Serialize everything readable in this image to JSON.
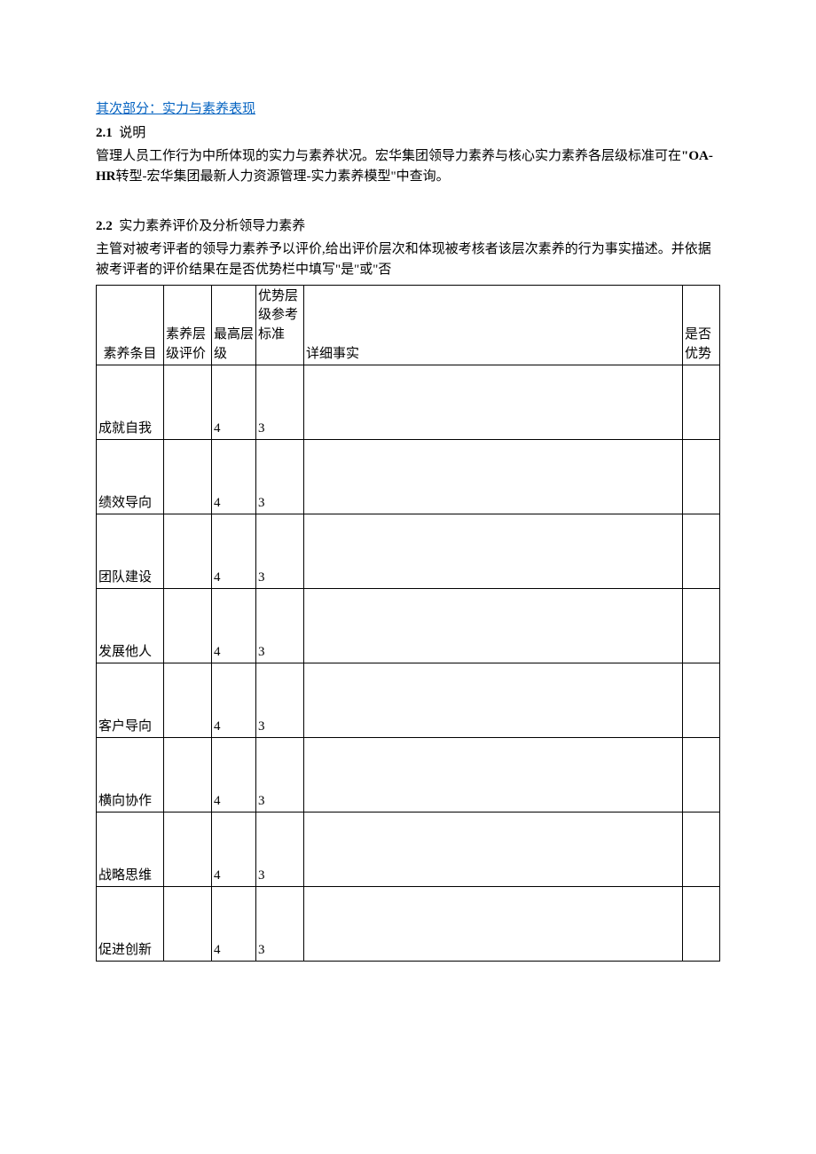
{
  "section_link": "其次部分：实力与素养表现",
  "s21": {
    "num": "2.1",
    "title": "说明"
  },
  "para1": {
    "text1": "管理人员工作行为中所体现的实力与素养状况。宏华集团领导力素养与核心实力素养各层级标准可在",
    "bold": "\"OA-HR",
    "text2": "转型-宏华集团最新人力资源管理-实力素养模型\"中查询。"
  },
  "s22": {
    "num": "2.2",
    "title": "实力素养评价及分析领导力素养"
  },
  "para2": "主管对被考评者的领导力素养予以评价,给出评价层次和体现被考核者该层次素养的行为事实描述。并依据被考评者的评价结果在是否优势栏中填写\"是\"或\"否",
  "table": {
    "headers": {
      "item": "素养条目",
      "eval": "素养层级评价",
      "max": "最高层级",
      "ref": "优势层级参考标准",
      "fact": "详细事实",
      "adv": "是否优势"
    },
    "rows": [
      {
        "item": "成就自我",
        "eval": "",
        "max": "4",
        "ref": "3",
        "fact": "",
        "adv": ""
      },
      {
        "item": "绩效导向",
        "eval": "",
        "max": "4",
        "ref": "3",
        "fact": "",
        "adv": ""
      },
      {
        "item": "团队建设",
        "eval": "",
        "max": "4",
        "ref": "3",
        "fact": "",
        "adv": ""
      },
      {
        "item": "发展他人",
        "eval": "",
        "max": "4",
        "ref": "3",
        "fact": "",
        "adv": ""
      },
      {
        "item": "客户导向",
        "eval": "",
        "max": "4",
        "ref": "3",
        "fact": "",
        "adv": ""
      },
      {
        "item": "横向协作",
        "eval": "",
        "max": "4",
        "ref": "3",
        "fact": "",
        "adv": ""
      },
      {
        "item": "战略思维",
        "eval": "",
        "max": "4",
        "ref": "3",
        "fact": "",
        "adv": ""
      },
      {
        "item": "促进创新",
        "eval": "",
        "max": "4",
        "ref": "3",
        "fact": "",
        "adv": ""
      }
    ]
  }
}
